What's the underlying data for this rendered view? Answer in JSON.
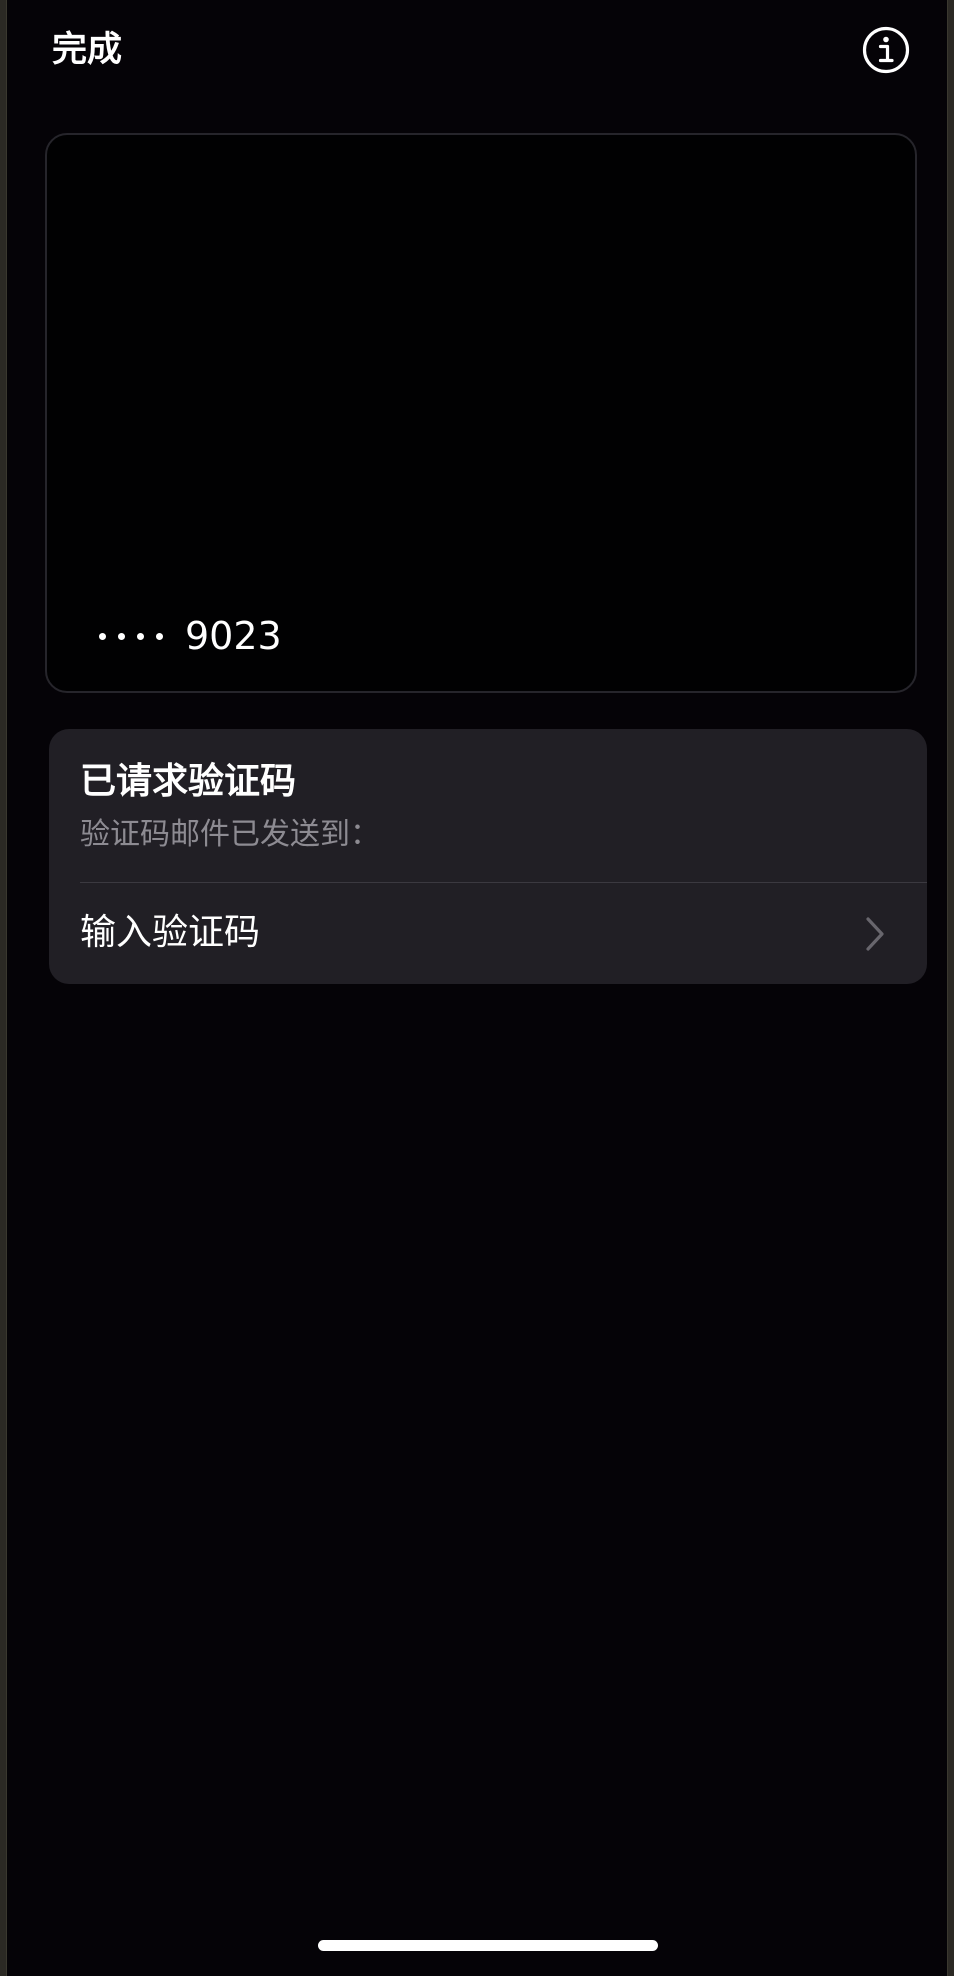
{
  "header": {
    "done_label": "完成",
    "info_icon": "info-circle-icon"
  },
  "card": {
    "masked_dots": "••••",
    "last_digits": "9023"
  },
  "verification": {
    "title": "已请求验证码",
    "subtitle": "验证码邮件已发送到：",
    "enter_code_label": "输入验证码",
    "chevron_icon": "chevron-right-icon"
  },
  "colors": {
    "background": "#050307",
    "panel": "#211f25",
    "secondary_text": "#8d8b92"
  }
}
